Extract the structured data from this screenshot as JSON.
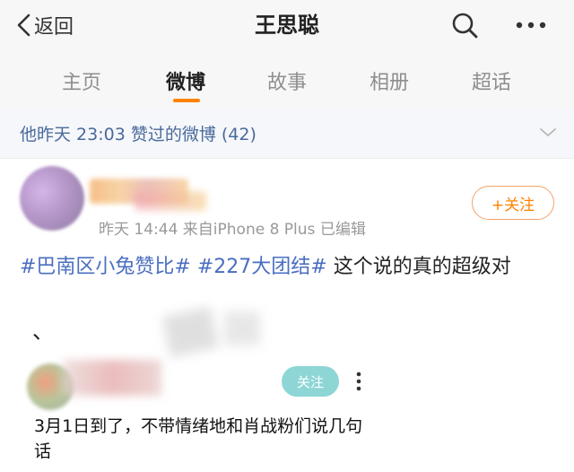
{
  "topbar": {
    "back_label": "返回",
    "title": "王思聪",
    "search_icon": "search-icon",
    "more_icon": "more-horizontal-icon"
  },
  "tabs": [
    {
      "label": "主页",
      "active": false
    },
    {
      "label": "微博",
      "active": true
    },
    {
      "label": "故事",
      "active": false
    },
    {
      "label": "相册",
      "active": false
    },
    {
      "label": "超话",
      "active": false
    }
  ],
  "liked_header": {
    "text": "他昨天 23:03 赞过的微博 (42)",
    "icon": "chevron-down-icon"
  },
  "post": {
    "meta": "昨天 14:44  来自iPhone 8 Plus  已编辑",
    "follow_label": "+关注",
    "hashtag1": "#巴南区小兔赞比#",
    "hashtag2": "#227大团结#",
    "text_rest": "这个说的真的超级对",
    "dun": "、"
  },
  "embedded": {
    "follow_label": "关注",
    "more_icon": "more-vertical-icon",
    "text": "3月1日到了，不带情绪地和肖战粉们说几句话"
  },
  "colors": {
    "accent": "#ff8200",
    "link": "#4a6ec1",
    "header_text": "#4a6a9a",
    "follow2_bg": "#8ed6d6"
  }
}
